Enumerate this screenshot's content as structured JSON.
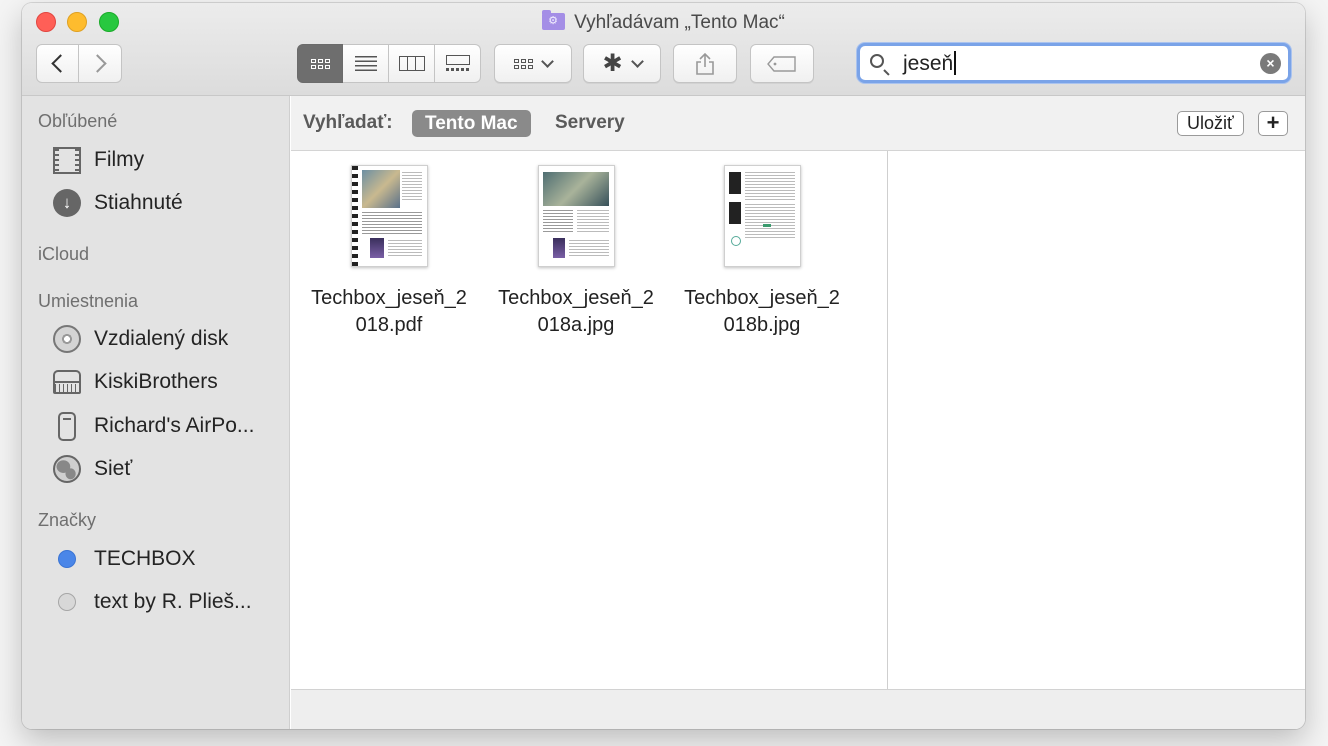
{
  "window": {
    "title": "Vyhľadávam „Tento Mac“"
  },
  "toolbar": {
    "view_icons": [
      "icon-view-icon",
      "list-view-icon",
      "column-view-icon",
      "gallery-view-icon"
    ],
    "group_icon": "group-by-icon",
    "action_icon": "gear-icon",
    "share_icon": "share-icon",
    "tag_icon": "tag-icon"
  },
  "search": {
    "value": "jeseň",
    "icon": "search-icon",
    "clear_icon": "clear-icon"
  },
  "sidebar": {
    "favorites_title": "Obľúbené",
    "favorites": [
      {
        "label": "Filmy",
        "icon": "film-icon"
      },
      {
        "label": "Stiahnuté",
        "icon": "download-icon"
      }
    ],
    "icloud_title": "iCloud",
    "locations_title": "Umiestnenia",
    "locations": [
      {
        "label": "Vzdialený disk",
        "icon": "disc-icon"
      },
      {
        "label": "KiskiBrothers",
        "icon": "nas-drive-icon"
      },
      {
        "label": "Richard's AirPo...",
        "icon": "airpods-icon"
      },
      {
        "label": "Sieť",
        "icon": "network-globe-icon"
      }
    ],
    "tags_title": "Značky",
    "tags": [
      {
        "label": "TECHBOX",
        "color": "#4a86e8"
      },
      {
        "label": "text by R. Plieš...",
        "color": "#d8d8d8"
      }
    ]
  },
  "scope": {
    "label": "Vyhľadať:",
    "selected": "Tento Mac",
    "other": "Servery",
    "save_label": "Uložiť",
    "add_label": "+"
  },
  "results": [
    {
      "name_line1": "Techbox_jeseň_2",
      "name_line2": "018.pdf"
    },
    {
      "name_line1": "Techbox_jeseň_2",
      "name_line2": "018a.jpg"
    },
    {
      "name_line1": "Techbox_jeseň_2",
      "name_line2": "018b.jpg"
    }
  ]
}
